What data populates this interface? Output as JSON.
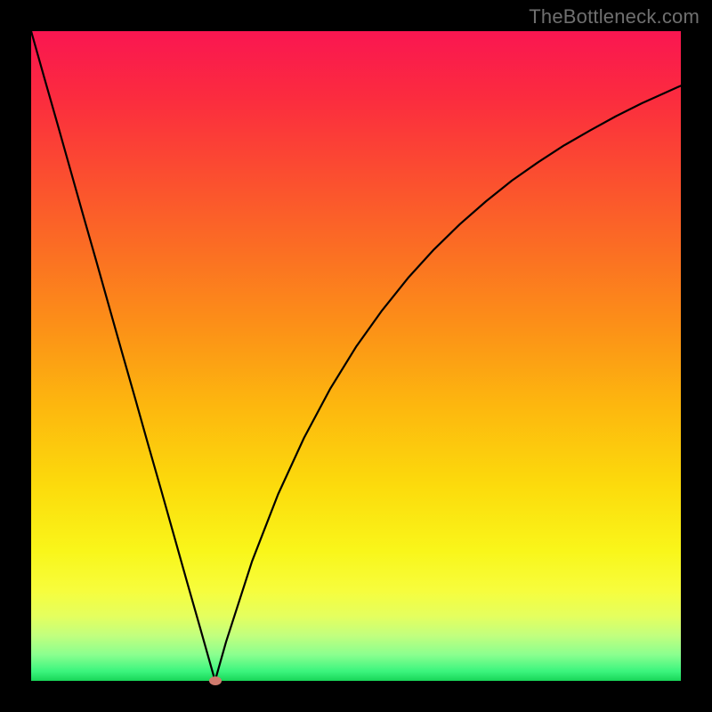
{
  "watermark": "TheBottleneck.com",
  "colors": {
    "frame": "#000000",
    "gradient_top": "#fa1651",
    "gradient_bottom": "#18d658",
    "curve": "#000000",
    "marker": "#d07a6d"
  },
  "chart_data": {
    "type": "line",
    "title": "",
    "xlabel": "",
    "ylabel": "",
    "xlim": [
      0,
      1
    ],
    "ylim": [
      0,
      1
    ],
    "x": [
      0.0,
      0.02,
      0.04,
      0.06,
      0.08,
      0.1,
      0.12,
      0.14,
      0.16,
      0.18,
      0.2,
      0.22,
      0.24,
      0.26,
      0.28,
      0.283,
      0.3,
      0.34,
      0.38,
      0.42,
      0.46,
      0.5,
      0.54,
      0.58,
      0.62,
      0.66,
      0.7,
      0.74,
      0.78,
      0.82,
      0.86,
      0.9,
      0.94,
      0.98,
      1.0
    ],
    "values": [
      1.0,
      0.929,
      0.859,
      0.788,
      0.717,
      0.647,
      0.576,
      0.505,
      0.435,
      0.364,
      0.294,
      0.223,
      0.152,
      0.082,
      0.011,
      0.0,
      0.06,
      0.184,
      0.287,
      0.374,
      0.449,
      0.514,
      0.57,
      0.62,
      0.664,
      0.703,
      0.738,
      0.77,
      0.798,
      0.824,
      0.847,
      0.869,
      0.889,
      0.907,
      0.916
    ],
    "minimum_marker": {
      "x": 0.283,
      "y": 0.0
    }
  }
}
